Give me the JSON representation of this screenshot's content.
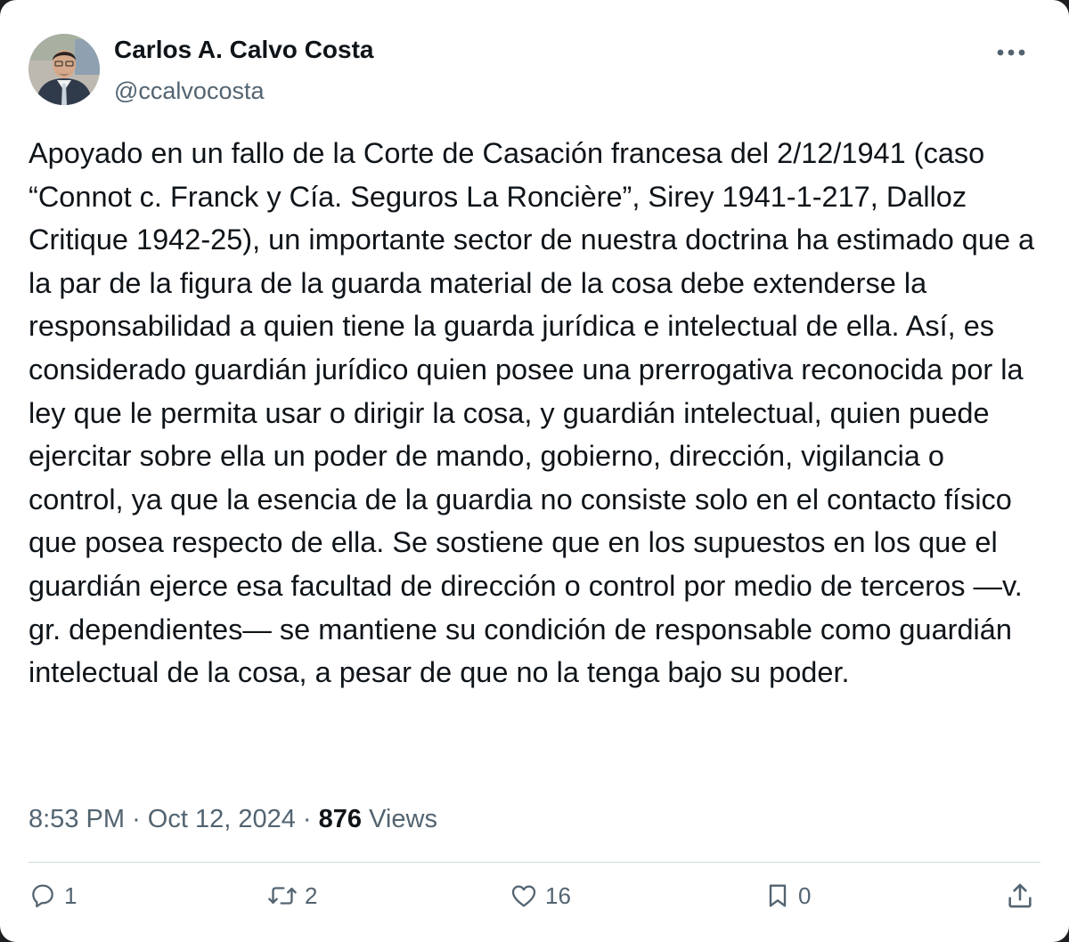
{
  "author": {
    "name": "Carlos A. Calvo Costa",
    "handle": "@ccalvocosta"
  },
  "post": {
    "text": "Apoyado en un fallo de la Corte de Casación francesa del 2/12/1941 (caso “Connot c. Franck y Cía. Seguros La Roncière”, Sirey 1941-1-217, Dalloz Critique 1942-25), un importante sector de nuestra doctrina ha estimado que a la par de la figura de la guarda material de la cosa debe extenderse la responsabilidad a quien tiene la guarda jurídica e intelectual de ella. Así, es considerado guardián jurídico quien posee una prerrogativa reconocida por la ley que le permita usar o dirigir la cosa, y guardián intelectual, quien puede ejercitar sobre ella un poder de mando, gobierno, dirección, vigilancia o control, ya que la esencia de la guardia no consiste solo en el contacto físico que posea respecto de ella. Se sostiene que en los supuestos en los que el guardián ejerce esa facultad de dirección o control por medio de terceros —v. gr. dependientes— se mantiene su condición de responsable como guardián intelectual de la cosa, a pesar de que no la tenga bajo su poder.",
    "time": "8:53 PM",
    "separator": "·",
    "date": "Oct 12, 2024",
    "views_count": "876",
    "views_label": "Views"
  },
  "actions": {
    "replies": "1",
    "reposts": "2",
    "likes": "16",
    "bookmarks": "0"
  },
  "icons": {
    "more": "more-horizontal-icon",
    "reply": "reply-icon",
    "repost": "repost-icon",
    "like": "heart-icon",
    "bookmark": "bookmark-icon",
    "share": "share-icon"
  },
  "colors": {
    "text": "#0f1419",
    "secondary": "#536471",
    "divider": "#cfd9de",
    "background": "#ffffff"
  }
}
